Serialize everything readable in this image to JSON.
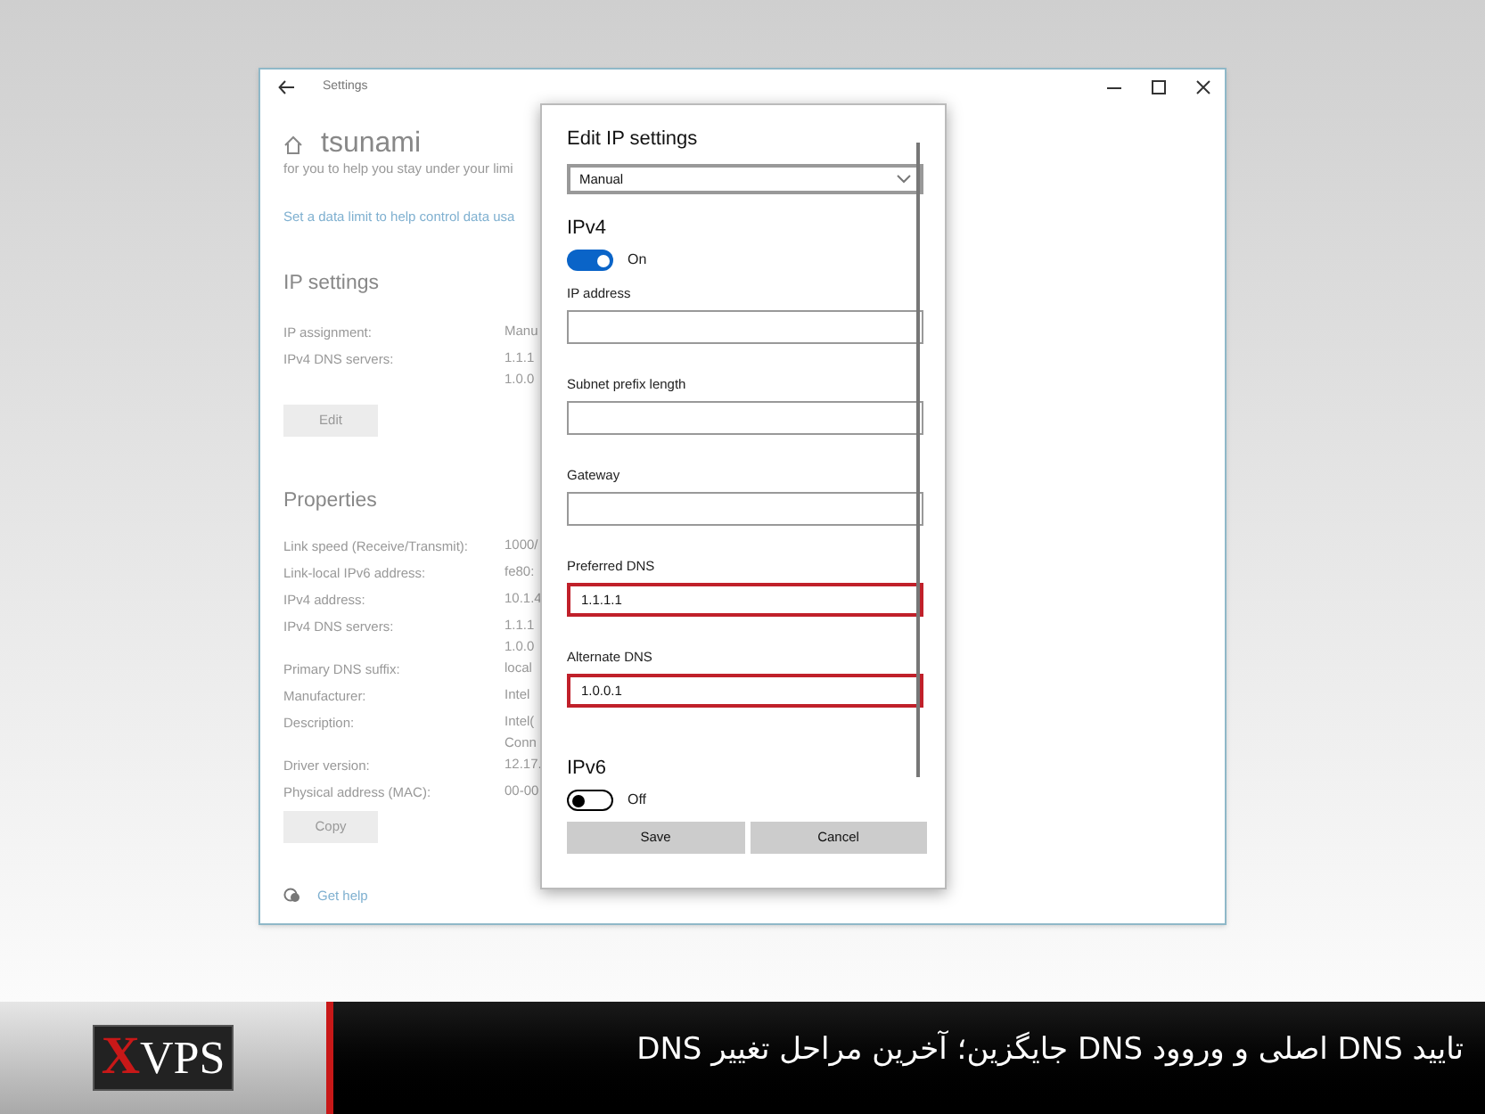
{
  "window": {
    "title": "Settings"
  },
  "page": {
    "title": "tsunami",
    "cut_line": "for you to help you stay under your limi",
    "link": "Set a data limit to help control data usa",
    "ip_settings": {
      "heading": "IP settings",
      "rows": [
        {
          "label": "IP assignment:",
          "values": [
            "Manu"
          ]
        },
        {
          "label": "IPv4 DNS servers:",
          "values": [
            "1.1.1",
            "1.0.0"
          ]
        }
      ],
      "button": "Edit"
    },
    "properties": {
      "heading": "Properties",
      "rows": [
        {
          "label": "Link speed (Receive/Transmit):",
          "values": [
            "1000/"
          ]
        },
        {
          "label": "Link-local IPv6 address:",
          "values": [
            "fe80:"
          ]
        },
        {
          "label": "IPv4 address:",
          "values": [
            "10.1.4"
          ]
        },
        {
          "label": "IPv4 DNS servers:",
          "values": [
            "1.1.1",
            "1.0.0"
          ]
        },
        {
          "label": "Primary DNS suffix:",
          "values": [
            "local"
          ]
        },
        {
          "label": "Manufacturer:",
          "values": [
            "Intel"
          ]
        },
        {
          "label": "Description:",
          "values": [
            "Intel(",
            "Conn"
          ]
        },
        {
          "label": "Driver version:",
          "values": [
            "12.17."
          ]
        },
        {
          "label": "Physical address (MAC):",
          "values": [
            "00-00"
          ]
        }
      ],
      "button": "Copy"
    },
    "help": "Get help"
  },
  "dialog": {
    "title": "Edit IP settings",
    "select": "Manual",
    "sections": [
      {
        "heading": "IPv4",
        "toggle": {
          "on": true,
          "label": "On"
        },
        "fields": [
          {
            "label": "IP address",
            "highlighted": false
          },
          {
            "label": "Subnet prefix length",
            "highlighted": false
          },
          {
            "label": "Gateway",
            "highlighted": false
          },
          {
            "label": "Preferred DNS",
            "value": "1.1.1.1",
            "highlighted": true
          },
          {
            "label": "Alternate DNS",
            "value": "1.0.0.1",
            "highlighted": true
          }
        ]
      },
      {
        "heading": "IPv6",
        "toggle": {
          "on": false,
          "label": "Off"
        }
      }
    ],
    "buttons": [
      "Save",
      "Cancel"
    ]
  },
  "banner": {
    "logo": [
      "X",
      "VPS"
    ],
    "caption": "تایید DNS اصلی و وروود DNS جایگزین؛ آخرین مراحل تغییر DNS"
  }
}
